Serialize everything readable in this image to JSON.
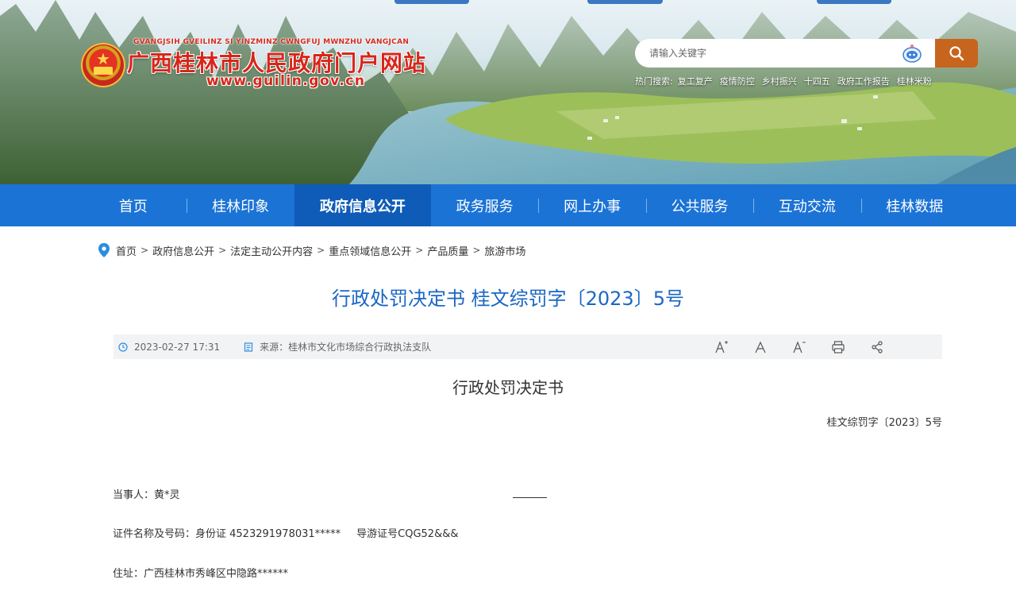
{
  "site": {
    "pinyin": "GVANGJSIH GVEILINZ SI YINZMINZ CWNGFUJ MWNZHU VANGJCAN",
    "title": "广西桂林市人民政府门户网站",
    "url": "www.guilin.gov.cn"
  },
  "search": {
    "placeholder": "请输入关键字",
    "hot_label": "热门搜索:",
    "hot_terms": [
      "复工复产",
      "疫情防控",
      "乡村振兴",
      "十四五",
      "政府工作报告",
      "桂林米粉"
    ]
  },
  "nav": {
    "items": [
      "首页",
      "桂林印象",
      "政府信息公开",
      "政务服务",
      "网上办事",
      "公共服务",
      "互动交流",
      "桂林数据"
    ],
    "active": "政府信息公开"
  },
  "breadcrumb": [
    "首页",
    "政府信息公开",
    "法定主动公开内容",
    "重点领域信息公开",
    "产品质量",
    "旅游市场"
  ],
  "article": {
    "title": "行政处罚决定书 桂文综罚字〔2023〕5号",
    "date": "2023-02-27 17:31",
    "source": "来源：桂林市文化市场综合行政执法支队",
    "tools": [
      "A+",
      "A",
      "A-",
      "print",
      "share"
    ],
    "heading": "行政处罚决定书",
    "doc_number": "桂文综罚字〔2023〕5号",
    "party": "当事人：黄*灵",
    "id_label": "证件名称及号码：身份证  4523291978031*****",
    "guide_cert": "导游证号CQG52&&&",
    "address": "住址：广西桂林市秀峰区中隐路******"
  },
  "colors": {
    "nav_bg": "#1b73d6",
    "nav_active": "#0f5cb8",
    "title_blue": "#1b67c4",
    "search_btn": "#c7641d",
    "logo_red": "#d8261a"
  }
}
